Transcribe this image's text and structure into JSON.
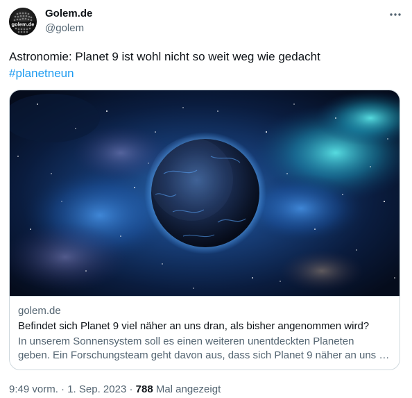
{
  "author": {
    "name": "Golem.de",
    "handle": "@golem",
    "avatar_text": "golem.de"
  },
  "tweet": {
    "text": "Astronomie: Planet 9 ist wohl nicht so weit weg wie gedacht",
    "hashtag": "#planetneun"
  },
  "card": {
    "domain": "golem.de",
    "title": "Befindet sich Planet 9 viel näher an uns dran, als bisher angenommen wird?",
    "description_line1": "In unserem Sonnensystem soll es einen weiteren unentdeckten Planeten",
    "description_line2": "geben. Ein Forschungsteam geht davon aus, dass sich Planet 9 näher an uns …"
  },
  "meta": {
    "time": "9:49 vorm.",
    "separator": " · ",
    "date": "1. Sep. 2023",
    "views_count": "788",
    "views_label": " Mal angezeigt"
  },
  "icons": {
    "more": "more-horizontal-icon",
    "avatar": "golem-logo"
  },
  "colors": {
    "link": "#1d9bf0",
    "secondary_text": "#536471",
    "primary_text": "#0f1419",
    "border": "#cfd9de"
  }
}
